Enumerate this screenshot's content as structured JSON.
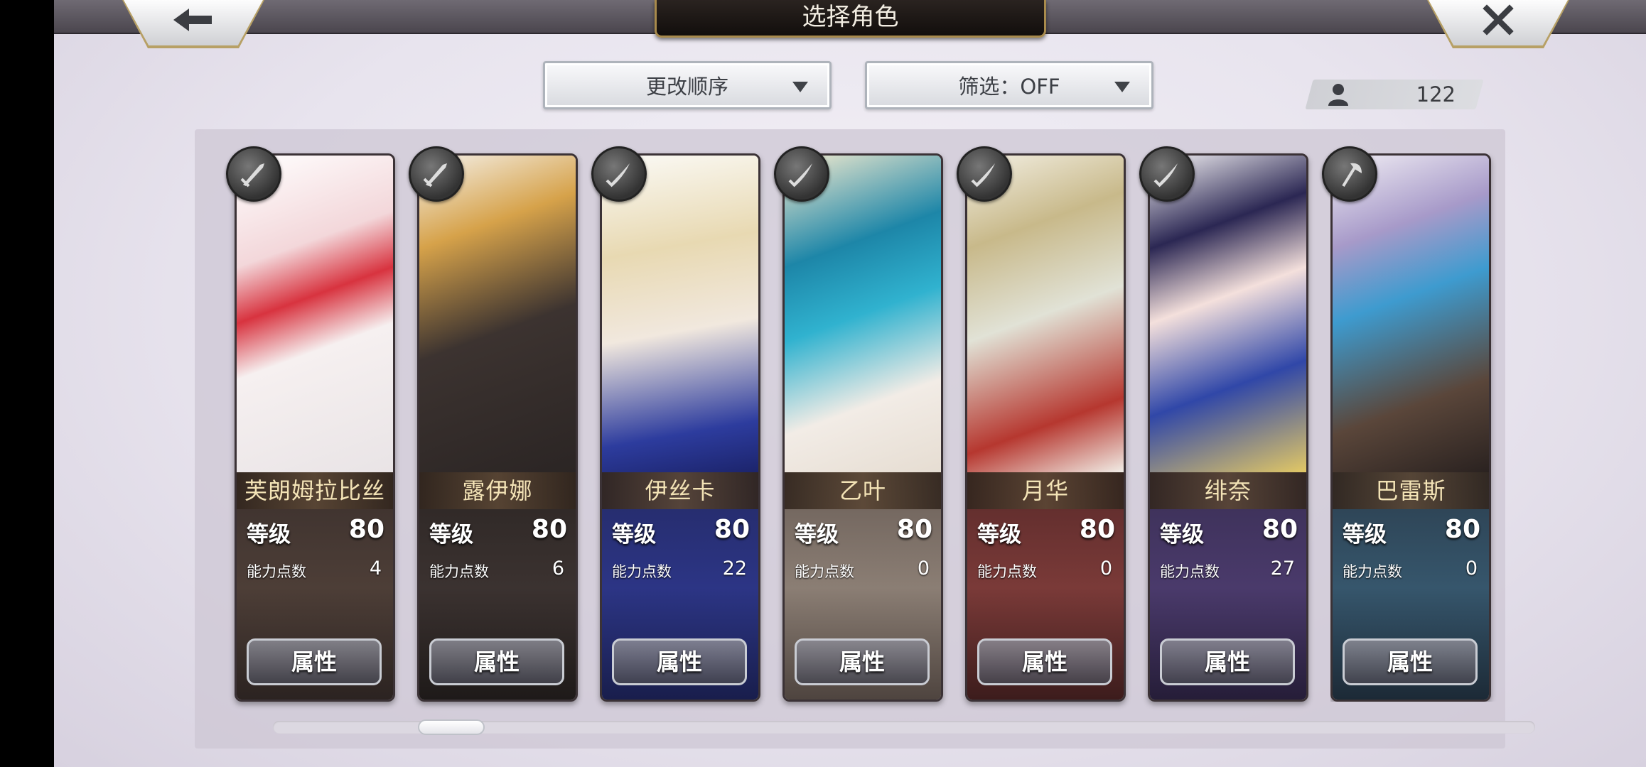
{
  "header": {
    "title": "选择角色"
  },
  "toolbar": {
    "sort_label": "更改顺序",
    "filter_label": "筛选：OFF",
    "roster_count": "122"
  },
  "characters": [
    {
      "name": "芙朗姆拉比丝",
      "level_label": "等级",
      "level": "80",
      "ap_label": "能力点数",
      "ap": "4",
      "attr_label": "属性",
      "weapon_icon": "sword-icon"
    },
    {
      "name": "露伊娜",
      "level_label": "等级",
      "level": "80",
      "ap_label": "能力点数",
      "ap": "6",
      "attr_label": "属性",
      "weapon_icon": "sword-icon"
    },
    {
      "name": "伊丝卡",
      "level_label": "等级",
      "level": "80",
      "ap_label": "能力点数",
      "ap": "22",
      "attr_label": "属性",
      "weapon_icon": "sword-icon"
    },
    {
      "name": "乙叶",
      "level_label": "等级",
      "level": "80",
      "ap_label": "能力点数",
      "ap": "0",
      "attr_label": "属性",
      "weapon_icon": "sword-icon"
    },
    {
      "name": "月华",
      "level_label": "等级",
      "level": "80",
      "ap_label": "能力点数",
      "ap": "0",
      "attr_label": "属性",
      "weapon_icon": "sword-icon"
    },
    {
      "name": "绯奈",
      "level_label": "等级",
      "level": "80",
      "ap_label": "能力点数",
      "ap": "27",
      "attr_label": "属性",
      "weapon_icon": "sword-icon"
    },
    {
      "name": "巴雷斯",
      "level_label": "等级",
      "level": "80",
      "ap_label": "能力点数",
      "ap": "0",
      "attr_label": "属性",
      "weapon_icon": "axe-icon"
    }
  ],
  "colors": {
    "name_text": "#f3e3b6",
    "frame_gold": "#a88a4c"
  }
}
